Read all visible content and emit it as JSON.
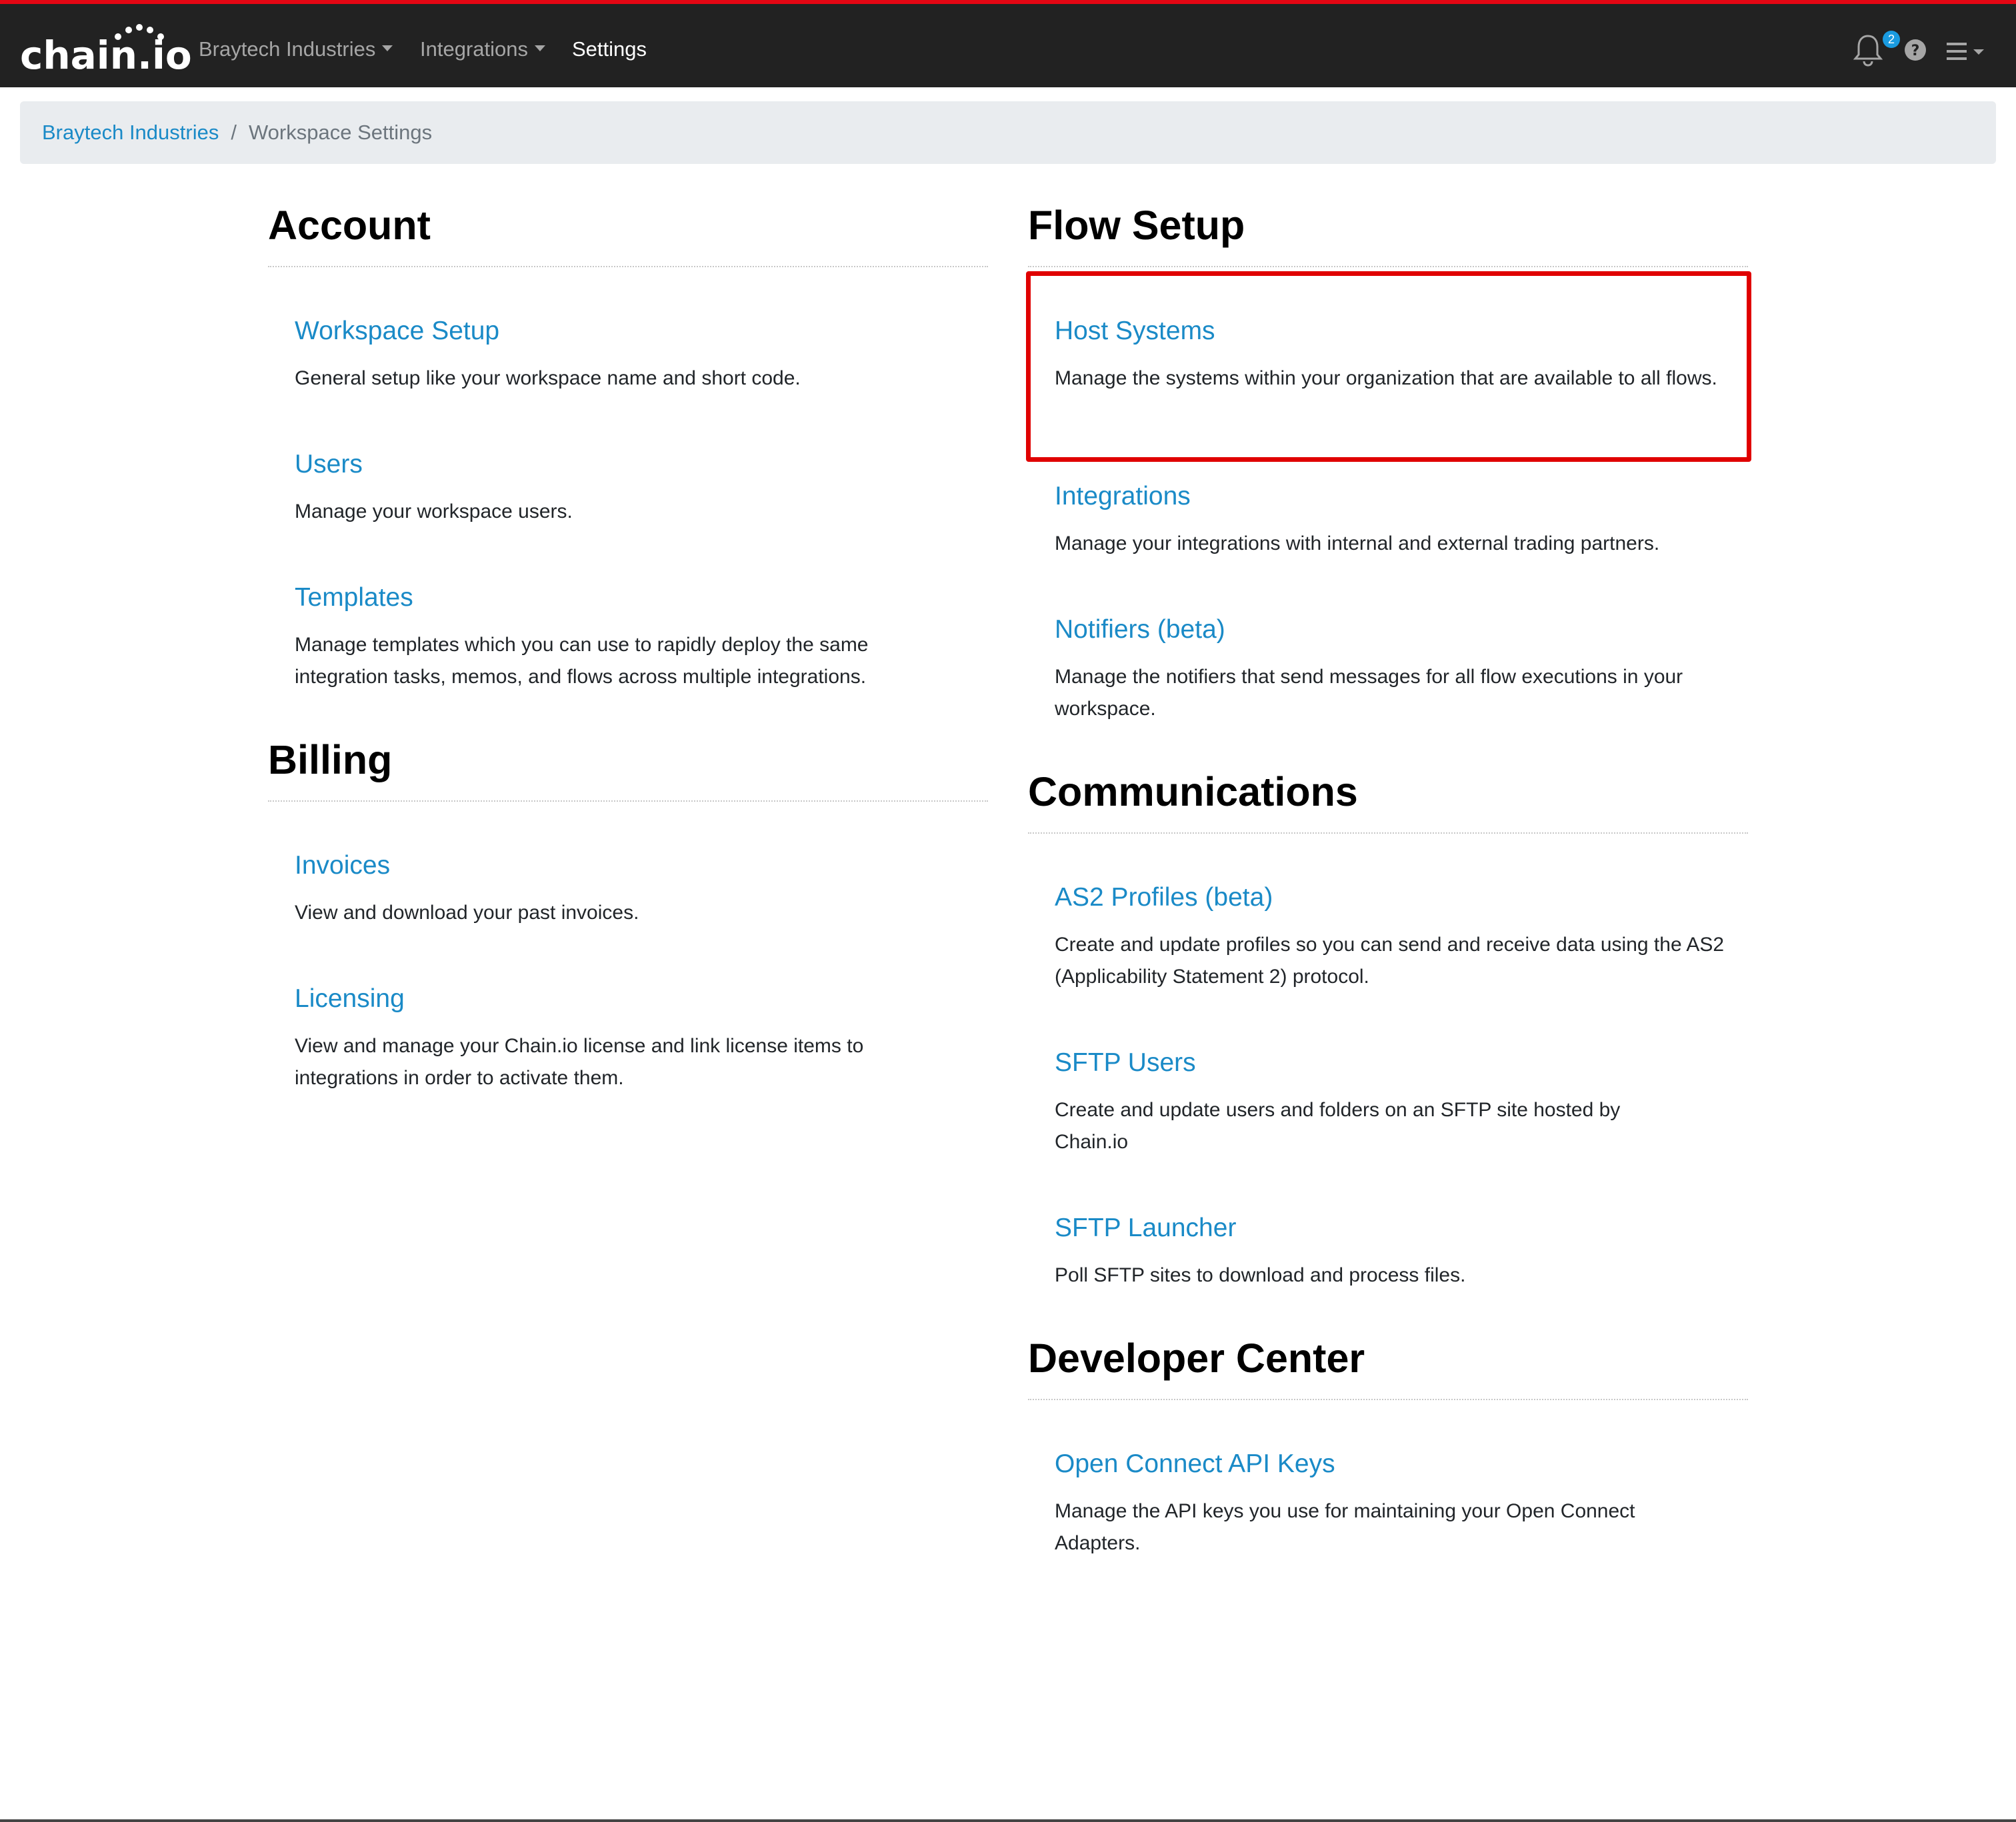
{
  "navbar": {
    "logo_text": "chain.io",
    "menu": [
      {
        "label": "Braytech Industries",
        "has_dropdown": true
      },
      {
        "label": "Integrations",
        "has_dropdown": true
      },
      {
        "label": "Settings",
        "has_dropdown": false,
        "active": true
      }
    ],
    "notification_count": "2",
    "icons": [
      "bell-icon",
      "help-icon",
      "hamburger-menu-icon"
    ]
  },
  "breadcrumb": {
    "items": [
      "Braytech Industries",
      "Workspace Settings"
    ],
    "separator": "/"
  },
  "left": {
    "account": {
      "title": "Account",
      "items": [
        {
          "title": "Workspace Setup",
          "description": "General setup like your workspace name and short code."
        },
        {
          "title": "Users",
          "description": "Manage your workspace users."
        },
        {
          "title": "Templates",
          "description": "Manage templates which you can use to rapidly deploy the same integration tasks, memos, and flows across multiple integrations."
        }
      ]
    },
    "billing": {
      "title": "Billing",
      "items": [
        {
          "title": "Invoices",
          "description": "View and download your past invoices."
        },
        {
          "title": "Licensing",
          "description": "View and manage your Chain.io license and link license items to integrations in order to activate them."
        }
      ]
    }
  },
  "right": {
    "flow_setup": {
      "title": "Flow Setup",
      "items": [
        {
          "title": "Host Systems",
          "description": "Manage the systems within your organization that are available to all flows.",
          "highlighted": true
        },
        {
          "title": "Integrations",
          "description": "Manage your integrations with internal and external trading partners."
        },
        {
          "title": "Notifiers (beta)",
          "description": "Manage the notifiers that send messages for all flow executions in your workspace."
        }
      ]
    },
    "communications": {
      "title": "Communications",
      "items": [
        {
          "title": "AS2 Profiles (beta)",
          "description": "Create and update profiles so you can send and receive data using the AS2 (Applicability Statement 2) protocol."
        },
        {
          "title": "SFTP Users",
          "description": "Create and update users and folders on an SFTP site hosted by Chain.io"
        },
        {
          "title": "SFTP Launcher",
          "description": "Poll SFTP sites to download and process files."
        }
      ]
    },
    "developer_center": {
      "title": "Developer Center",
      "items": [
        {
          "title": "Open Connect API Keys",
          "description": "Manage the API keys you use for maintaining your Open Connect Adapters."
        }
      ]
    }
  },
  "colors": {
    "navbar_bg": "#222222",
    "accent_red": "#e30613",
    "link_blue": "#1a8ac7",
    "highlight_red": "#e00000",
    "badge_blue": "#1a9be0",
    "breadcrumb_bg": "#e9ecef"
  }
}
